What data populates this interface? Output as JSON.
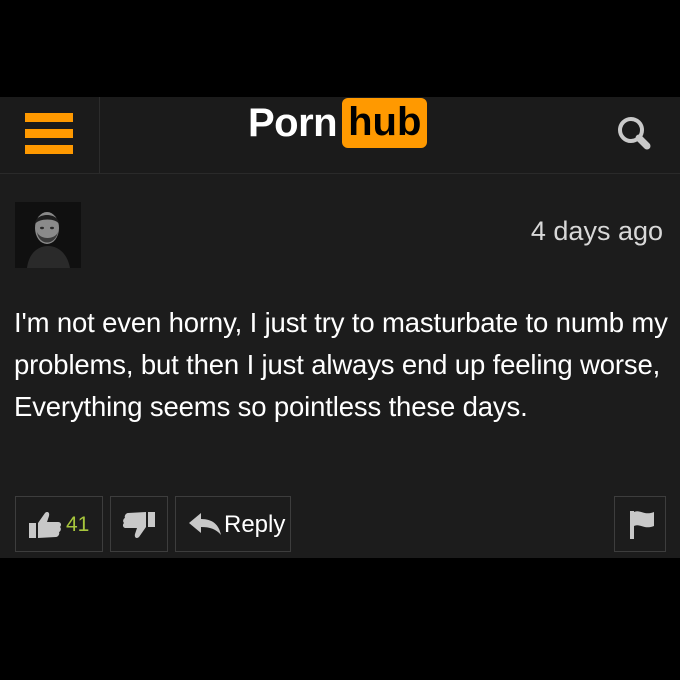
{
  "header": {
    "logo_part1": "Porn",
    "logo_part2": "hub",
    "menu_icon": "hamburger-menu-icon",
    "search_icon": "search-icon"
  },
  "comment": {
    "timestamp": "4 days ago",
    "text": "I'm not even horny, I just try to masturbate to numb my problems, but then I just always end up feeling worse, Everything seems so pointless these days.",
    "avatar_icon": "user-avatar"
  },
  "actions": {
    "like_count": "41",
    "reply_label": "Reply",
    "like_icon": "thumbs-up-icon",
    "dislike_icon": "thumbs-down-icon",
    "reply_icon": "reply-arrow-icon",
    "flag_icon": "flag-icon"
  },
  "colors": {
    "accent": "#ff9900",
    "like_count": "#a7c63c",
    "panel": "#1c1c1c",
    "background": "#000000"
  }
}
